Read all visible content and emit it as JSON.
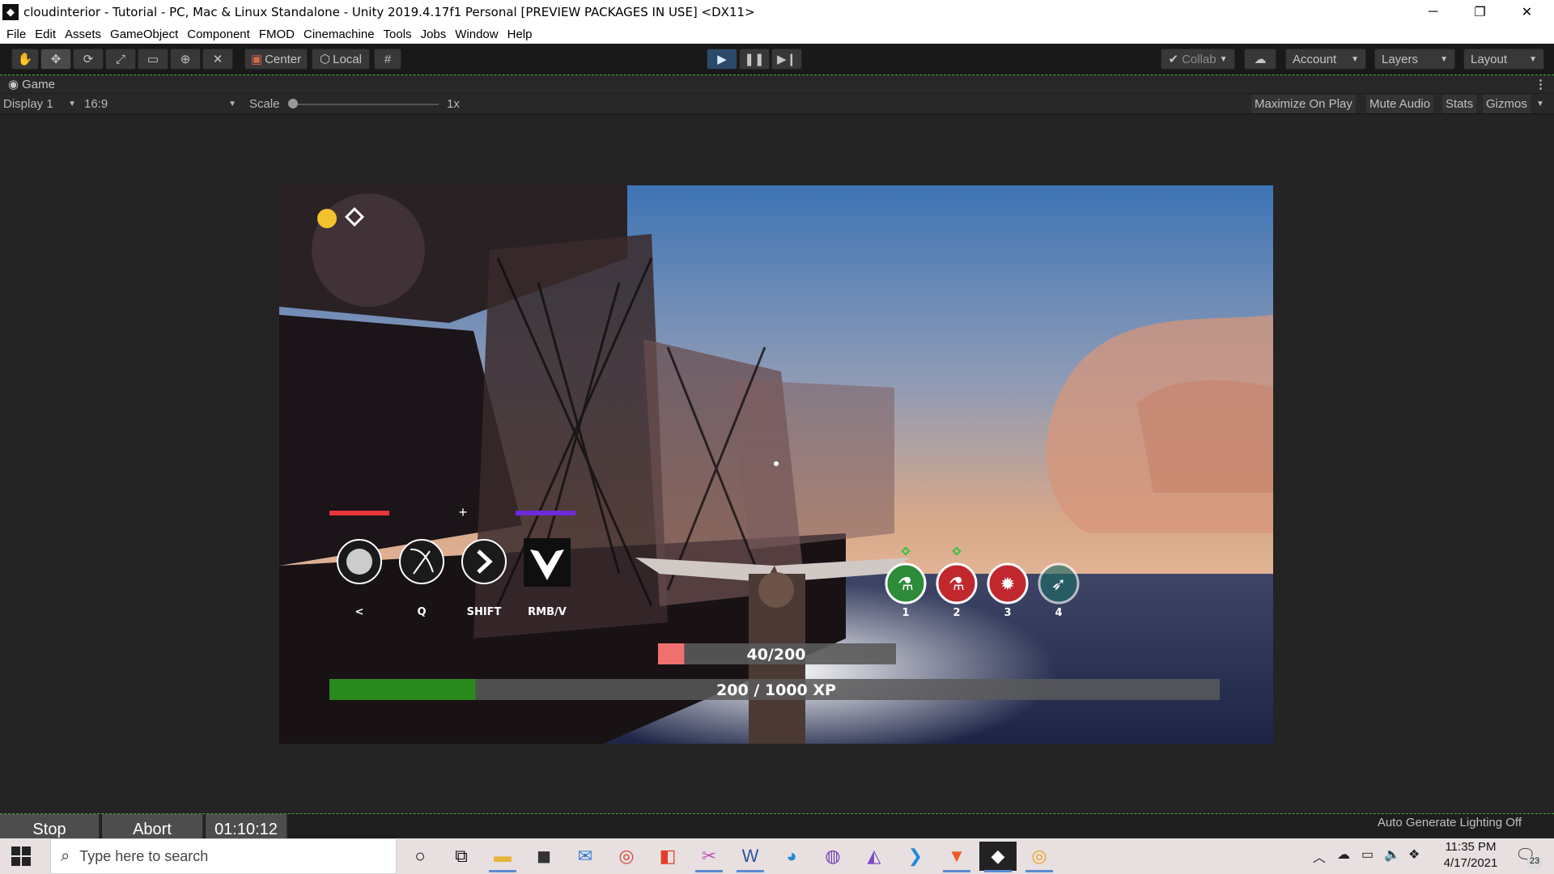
{
  "window": {
    "title": "cloudinterior - Tutorial - PC, Mac & Linux Standalone - Unity 2019.4.17f1 Personal [PREVIEW PACKAGES IN USE] <DX11>",
    "minimize": "─",
    "restore": "❐",
    "close": "✕"
  },
  "menu": [
    "File",
    "Edit",
    "Assets",
    "GameObject",
    "Component",
    "FMOD",
    "Cinemachine",
    "Tools",
    "Jobs",
    "Window",
    "Help"
  ],
  "toolbar": {
    "tools": [
      "hand-tool-icon",
      "move-tool-icon",
      "rotate-tool-icon",
      "scale-tool-icon",
      "rect-tool-icon",
      "transform-tool-icon",
      "custom-tool-icon"
    ],
    "pivot": "Center",
    "space": "Local",
    "collab": "Collab",
    "account": "Account",
    "layers": "Layers",
    "layout": "Layout",
    "play_state": "playing"
  },
  "game_view": {
    "tab": "Game",
    "display": "Display 1",
    "aspect": "16:9",
    "scale_label": "Scale",
    "scale_value": "1x",
    "maximize": "Maximize On Play",
    "mute": "Mute Audio",
    "stats": "Stats",
    "gizmos": "Gizmos"
  },
  "hud": {
    "abilities": [
      {
        "key": "<",
        "icon": "lion-head-icon"
      },
      {
        "key": "Q",
        "icon": "grappling-hook-icon"
      },
      {
        "key": "SHIFT",
        "icon": "chevron-right-icon"
      },
      {
        "key": "RMB/V",
        "icon": "wings-icon"
      }
    ],
    "health_text": "40/200",
    "health_value": 40,
    "health_max": 200,
    "xp_text": "200 / 1000 XP",
    "xp_value": 200,
    "xp_max": 1000,
    "spells": [
      {
        "slot": "1",
        "color": "#2e8b3a",
        "icon": "potion-icon",
        "ready": true
      },
      {
        "slot": "2",
        "color": "#c0282e",
        "icon": "potion-icon",
        "ready": true
      },
      {
        "slot": "3",
        "color": "#c0282e",
        "icon": "burst-icon",
        "ready": false
      },
      {
        "slot": "4",
        "color": "#1e6b66",
        "icon": "feather-icon",
        "ready": false
      }
    ]
  },
  "status": {
    "stop": "Stop",
    "abort": "Abort",
    "timer": "01:10:12",
    "lighting": "Auto Generate Lighting Off"
  },
  "taskbar": {
    "search_placeholder": "Type here to search",
    "time": "11:35 PM",
    "date": "4/17/2021",
    "notifications": "23",
    "apps": [
      "cortana-icon",
      "task-view-icon",
      "file-explorer-icon",
      "store-icon",
      "mail-icon",
      "chrome-icon",
      "office-icon",
      "snip-icon",
      "word-icon",
      "edge-icon",
      "github-icon",
      "visual-studio-icon",
      "vscode-icon",
      "brave-icon",
      "unity-icon",
      "chrome-canary-icon"
    ]
  }
}
